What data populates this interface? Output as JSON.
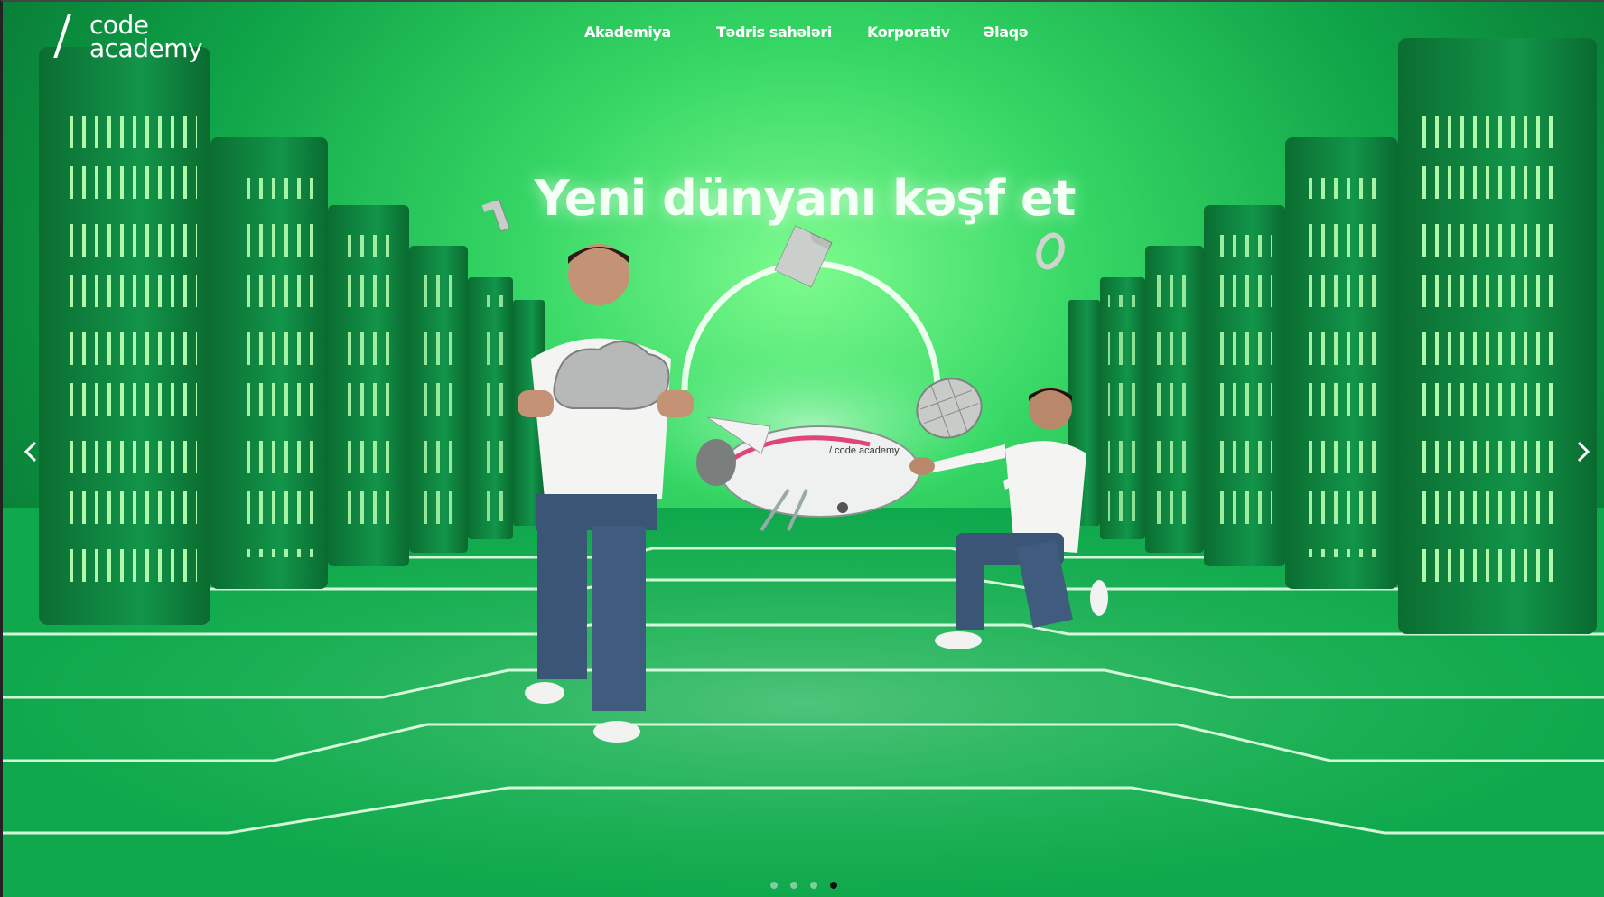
{
  "brand": {
    "logo_line1": "code",
    "logo_line2": "academy"
  },
  "nav": {
    "items": [
      {
        "label": "Akademiya"
      },
      {
        "label": "Tədris sahələri"
      },
      {
        "label": "Korporativ"
      },
      {
        "label": "Əlaqə"
      }
    ]
  },
  "hero": {
    "title": "Yeni dünyanı kəşf et",
    "illustration_alt": "Two students in a green server room with a spaceship, cloud and floating icons"
  },
  "carousel": {
    "prev_icon": "chevron-left-icon",
    "next_icon": "chevron-right-icon",
    "slide_count": 4,
    "active_slide": 4
  },
  "colors": {
    "accent_green": "#1fd764",
    "deep_green": "#087a35",
    "text": "#ffffff"
  }
}
